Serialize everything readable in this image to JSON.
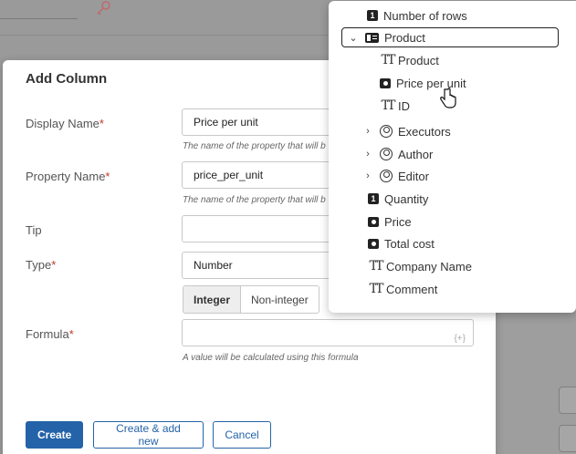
{
  "dialog": {
    "title": "Add Column",
    "fields": {
      "display_name": {
        "label": "Display Name",
        "required_mark": "*",
        "value": "Price per unit",
        "hint": "The name of the property that will b"
      },
      "property_name": {
        "label": "Property Name",
        "required_mark": "*",
        "value": "price_per_unit",
        "hint": "The name of the property that will b"
      },
      "tip": {
        "label": "Tip",
        "value": ""
      },
      "type": {
        "label": "Type",
        "required_mark": "*",
        "value": "Number"
      },
      "number_kind": {
        "options": [
          "Integer",
          "Non-integer"
        ],
        "selected": "Integer"
      },
      "formula": {
        "label": "Formula",
        "required_mark": "*",
        "value": "",
        "icon_text": "{+}",
        "hint": "A value will be calculated using this formula"
      }
    },
    "buttons": {
      "create": "Create",
      "create_add_new": "Create & add new",
      "cancel": "Cancel"
    }
  },
  "tree": {
    "items": [
      {
        "label": "Number of rows",
        "icon": "number-icon"
      },
      {
        "label": "Product",
        "icon": "object-icon",
        "expanded": true,
        "selected": true
      },
      {
        "label": "Product",
        "icon": "text-icon"
      },
      {
        "label": "Price per unit",
        "icon": "money-icon"
      },
      {
        "label": "ID",
        "icon": "text-icon"
      },
      {
        "label": "Executors",
        "icon": "user-icon",
        "collapsed": true
      },
      {
        "label": "Author",
        "icon": "user-icon",
        "collapsed": true
      },
      {
        "label": "Editor",
        "icon": "user-icon",
        "collapsed": true
      },
      {
        "label": "Quantity",
        "icon": "number-icon"
      },
      {
        "label": "Price",
        "icon": "money-icon"
      },
      {
        "label": "Total cost",
        "icon": "money-icon"
      },
      {
        "label": "Company Name",
        "icon": "text-icon"
      },
      {
        "label": "Comment",
        "icon": "text-icon"
      }
    ]
  },
  "colors": {
    "primary": "#2563a8",
    "required": "#c0392b",
    "overlay": "#9a9a9a"
  }
}
